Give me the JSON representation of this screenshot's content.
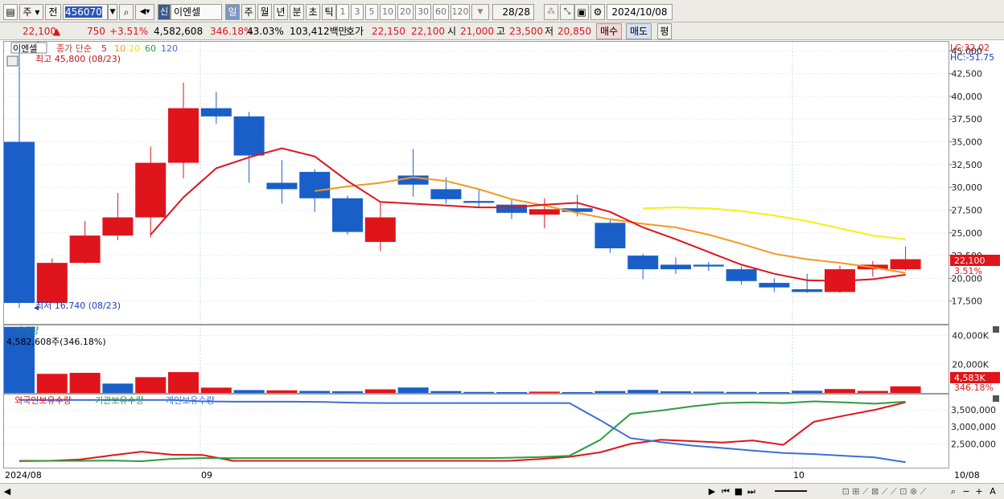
{
  "toolbar": {
    "period_label": "주",
    "prev_label": "전",
    "stock_code": "456070",
    "market_badge": "신",
    "stock_name": "이엔셀",
    "timeframes": [
      "일",
      "주",
      "월",
      "년",
      "분",
      "초",
      "틱"
    ],
    "intervals": [
      "1",
      "3",
      "5",
      "10",
      "20",
      "30",
      "60",
      "120"
    ],
    "page_counter": "28/28",
    "date": "2024/10/08"
  },
  "quote": {
    "price": "22,100",
    "change_arrow": "▲",
    "change": "750",
    "change_pct": "+3.51%",
    "volume": "4,582,608",
    "volume_ratio": "346.18%",
    "turnover": "43.03%",
    "amount": "103,412백만",
    "ask_label": "호가",
    "ask": "22,150",
    "bid": "22,100",
    "open_label": "시",
    "open": "21,000",
    "high_label": "고",
    "high": "23,500",
    "low_label": "저",
    "low": "20,850",
    "buy_label": "매수",
    "sell_label": "매도",
    "avg_label": "평"
  },
  "price_pane": {
    "stock_tag": "이엔셀",
    "ma_title": "종가 단순",
    "ma_periods": [
      "5",
      "10",
      "20",
      "60",
      "120"
    ],
    "ma_colors": [
      "#e0141b",
      "#f39a1c",
      "#f1f119",
      "#2e9d3e",
      "#3a6fd8"
    ],
    "high_marker": "최고 45,800 (08/23)",
    "low_marker": "최저 16,740 (08/23)",
    "lc_label": "LC:32.02",
    "hc_label": "HC:-51.75",
    "current_price_tag": "22,100",
    "current_pct_tag": "3.51%"
  },
  "volume_pane": {
    "title": "거래량",
    "info": "4,582,608주(346.18%)",
    "last_tag": "4,583K",
    "last_pct": "346.18%"
  },
  "holdings_pane": {
    "legend": [
      "외국인보유수량",
      "기관보유수량",
      "개인보유수량"
    ]
  },
  "x_axis": {
    "labels": [
      "2024/08",
      "09",
      "10"
    ],
    "end_label": "10/08"
  },
  "chart_data": [
    {
      "type": "candlestick",
      "y_ticks": [
        17500,
        20000,
        22500,
        25000,
        27500,
        30000,
        32500,
        35000,
        37500,
        40000,
        42500,
        45000
      ],
      "y_tick_labels": [
        "17,500",
        "20,000",
        "22,500",
        "25,000",
        "27,500",
        "30,000",
        "32,500",
        "35,000",
        "37,500",
        "40,000",
        "42,500",
        "45,000"
      ],
      "ylim": [
        15000,
        46000
      ],
      "candles": [
        {
          "o": 35000,
          "h": 45800,
          "l": 16740,
          "c": 17300
        },
        {
          "o": 17300,
          "h": 22200,
          "l": 17300,
          "c": 21700
        },
        {
          "o": 21700,
          "h": 26300,
          "l": 21600,
          "c": 24700
        },
        {
          "o": 24700,
          "h": 29400,
          "l": 24200,
          "c": 26700
        },
        {
          "o": 26700,
          "h": 34500,
          "l": 24500,
          "c": 32700
        },
        {
          "o": 32700,
          "h": 41500,
          "l": 31000,
          "c": 38700
        },
        {
          "o": 38700,
          "h": 40500,
          "l": 37000,
          "c": 37800
        },
        {
          "o": 37800,
          "h": 38300,
          "l": 30500,
          "c": 33500
        },
        {
          "o": 30500,
          "h": 33000,
          "l": 28200,
          "c": 29800
        },
        {
          "o": 31700,
          "h": 32000,
          "l": 27300,
          "c": 28800
        },
        {
          "o": 28800,
          "h": 29100,
          "l": 24800,
          "c": 25100
        },
        {
          "o": 24000,
          "h": 28500,
          "l": 23000,
          "c": 26700
        },
        {
          "o": 31300,
          "h": 34200,
          "l": 29000,
          "c": 30300
        },
        {
          "o": 29800,
          "h": 31100,
          "l": 28200,
          "c": 28700
        },
        {
          "o": 28500,
          "h": 29700,
          "l": 27800,
          "c": 28300
        },
        {
          "o": 28100,
          "h": 28600,
          "l": 26500,
          "c": 27200
        },
        {
          "o": 27000,
          "h": 28800,
          "l": 25500,
          "c": 27600
        },
        {
          "o": 27700,
          "h": 29200,
          "l": 26800,
          "c": 27300
        },
        {
          "o": 26100,
          "h": 26400,
          "l": 22800,
          "c": 23300
        },
        {
          "o": 22500,
          "h": 22700,
          "l": 19900,
          "c": 21000
        },
        {
          "o": 21500,
          "h": 22300,
          "l": 20500,
          "c": 21000
        },
        {
          "o": 21500,
          "h": 21800,
          "l": 20800,
          "c": 21300
        },
        {
          "o": 21000,
          "h": 21300,
          "l": 19300,
          "c": 19700
        },
        {
          "o": 19500,
          "h": 20000,
          "l": 18500,
          "c": 19000
        },
        {
          "o": 18800,
          "h": 20500,
          "l": 18400,
          "c": 18500
        },
        {
          "o": 18500,
          "h": 21400,
          "l": 18400,
          "c": 21000
        },
        {
          "o": 21000,
          "h": 21900,
          "l": 20200,
          "c": 21500
        },
        {
          "o": 21000,
          "h": 23500,
          "l": 20850,
          "c": 22100
        }
      ],
      "ma5": [
        null,
        null,
        null,
        null,
        24800,
        28900,
        32100,
        33300,
        34300,
        33400,
        30700,
        28400,
        28200,
        28000,
        27800,
        27800,
        28100,
        28300,
        27300,
        25600,
        24300,
        22900,
        21500,
        20500,
        19800,
        19700,
        19900,
        20400
      ],
      "ma10": [
        null,
        null,
        null,
        null,
        null,
        null,
        null,
        null,
        null,
        29600,
        30100,
        30500,
        31100,
        30700,
        29800,
        28700,
        28000,
        27200,
        26500,
        26000,
        25600,
        24800,
        23800,
        22700,
        22100,
        21700,
        21200,
        20600
      ],
      "ma20": [
        null,
        null,
        null,
        null,
        null,
        null,
        null,
        null,
        null,
        null,
        null,
        null,
        null,
        null,
        null,
        null,
        null,
        null,
        null,
        27700,
        27800,
        27700,
        27400,
        26900,
        26300,
        25500,
        24700,
        24300
      ]
    },
    {
      "type": "bar",
      "title": "거래량",
      "y_ticks": [
        20000,
        40000
      ],
      "y_tick_labels": [
        "20,000K",
        "40,000K"
      ],
      "ylim": [
        0,
        47000
      ],
      "values": [
        46000,
        13300,
        14000,
        6500,
        11000,
        14500,
        3700,
        2000,
        1800,
        1400,
        1200,
        2500,
        3800,
        1300,
        700,
        600,
        900,
        600,
        1300,
        2100,
        1100,
        900,
        700,
        600,
        1500,
        2700,
        1400,
        4583
      ],
      "up": [
        false,
        true,
        true,
        false,
        true,
        true,
        true,
        false,
        true,
        false,
        false,
        true,
        false,
        false,
        false,
        false,
        true,
        false,
        false,
        false,
        false,
        false,
        false,
        false,
        false,
        true,
        true,
        true
      ]
    },
    {
      "type": "line",
      "y_ticks": [
        2500000,
        3000000,
        3500000
      ],
      "y_tick_labels": [
        "2,500,000",
        "3,000,000",
        "3,500,000"
      ],
      "ylim": [
        1800000,
        3950000
      ],
      "series": [
        {
          "name": "외국인보유수량",
          "color": "#e0141b",
          "values": [
            2000000,
            2000000,
            2040000,
            2160000,
            2270000,
            2180000,
            2170000,
            2000000,
            2000000,
            2000000,
            2000000,
            2000000,
            2000000,
            2000000,
            2000000,
            2000000,
            2000000,
            2050000,
            2120000,
            2250000,
            2500000,
            2620000,
            2580000,
            2540000,
            2600000,
            2470000,
            3150000,
            3330000,
            3500000,
            3720000
          ]
        },
        {
          "name": "기관보유수량",
          "color": "#2e9d3e",
          "values": [
            1990000,
            2000000,
            2000000,
            2010000,
            1990000,
            2060000,
            2080000,
            2080000,
            2080000,
            2080000,
            2080000,
            2080000,
            2080000,
            2080000,
            2080000,
            2080000,
            2090000,
            2110000,
            2150000,
            2610000,
            3380000,
            3480000,
            3600000,
            3700000,
            3720000,
            3700000,
            3750000,
            3720000,
            3680000,
            3740000
          ]
        },
        {
          "name": "개인보유수량",
          "color": "#3a6fd8",
          "values": [
            3790000,
            3790000,
            3790000,
            3790000,
            3790000,
            3790000,
            3750000,
            3740000,
            3740000,
            3740000,
            3730000,
            3710000,
            3700000,
            3700000,
            3700000,
            3700000,
            3700000,
            3700000,
            3700000,
            3200000,
            2670000,
            2550000,
            2450000,
            2380000,
            2300000,
            2230000,
            2200000,
            2150000,
            2100000,
            1960000
          ]
        }
      ]
    }
  ]
}
